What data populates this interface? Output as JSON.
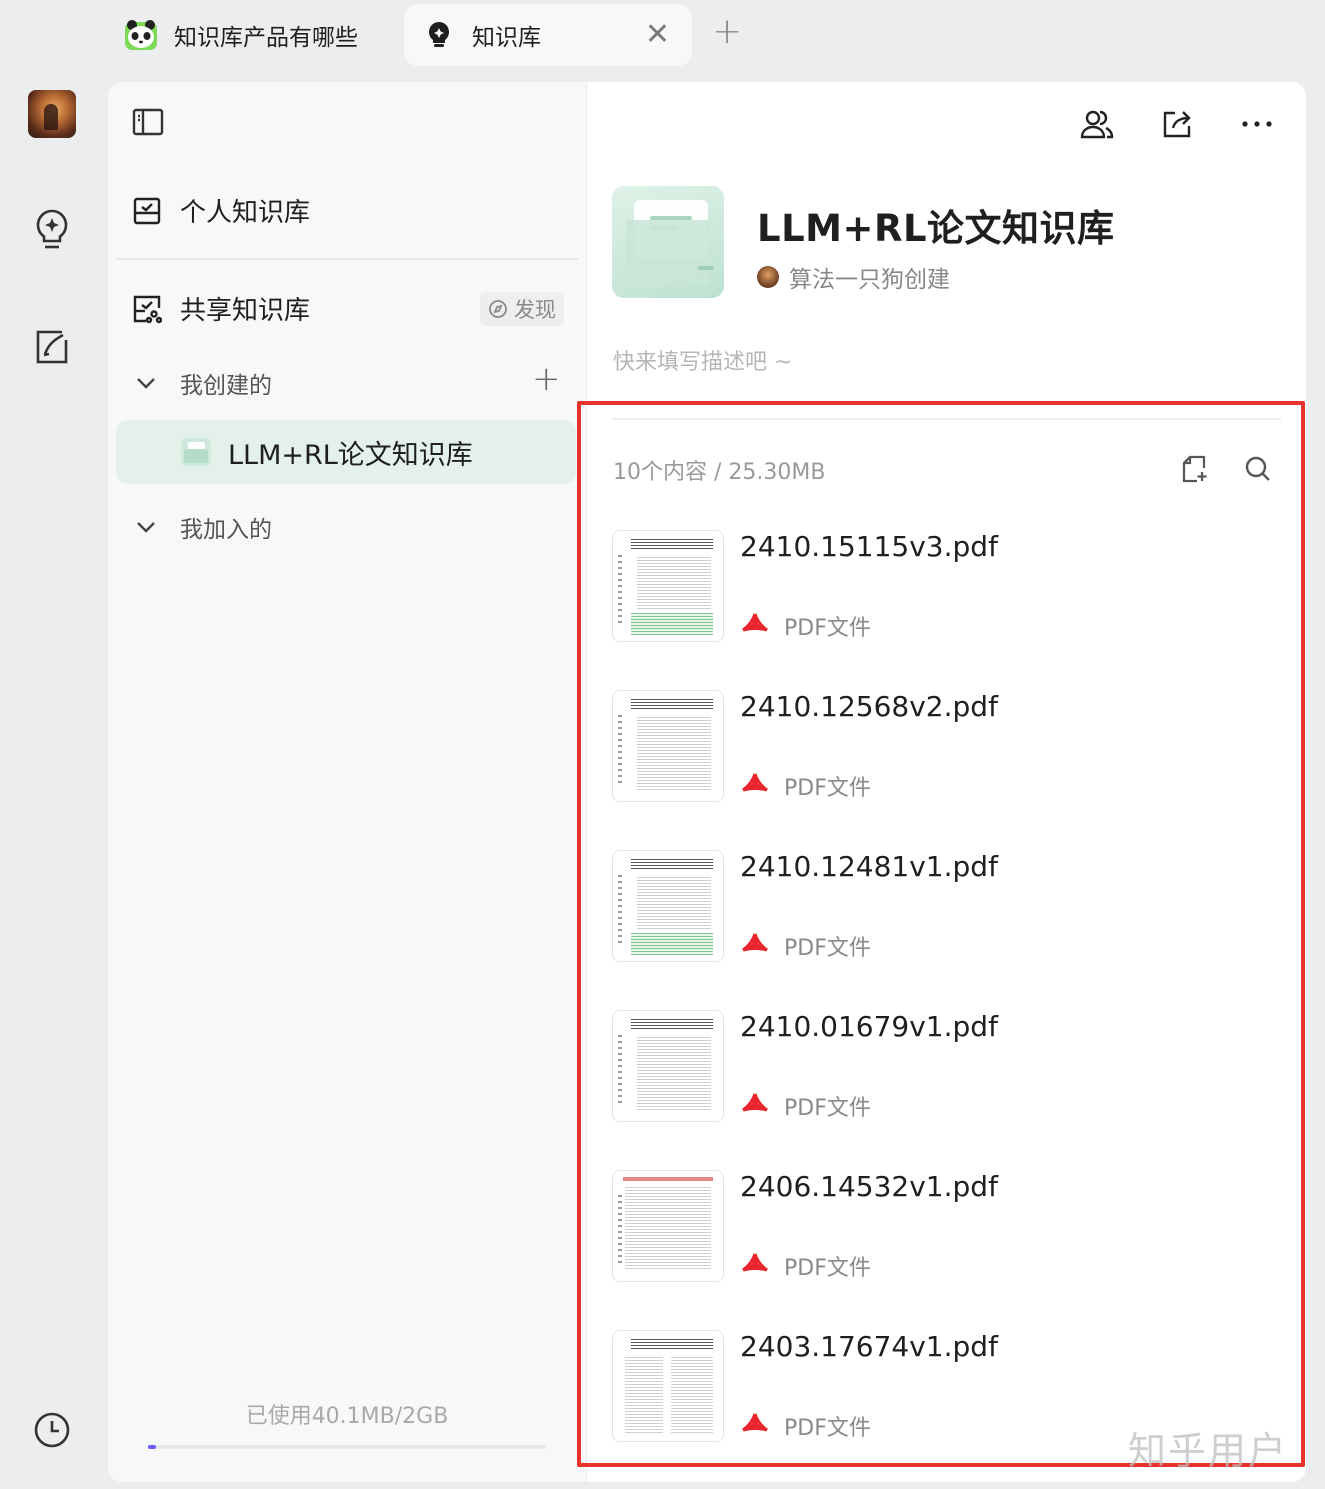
{
  "tabs": [
    {
      "label": "知识库产品有哪些",
      "icon": "panda-icon",
      "active": false
    },
    {
      "label": "知识库",
      "icon": "bulb-icon",
      "active": true
    }
  ],
  "tab_close": "✕",
  "tab_add": "+",
  "sidebar": {
    "personal_label": "个人知识库",
    "shared_label": "共享知识库",
    "discover_label": "发现",
    "groups": {
      "created": {
        "label": "我创建的"
      },
      "joined": {
        "label": "我加入的"
      }
    },
    "active_item": "LLM+RL论文知识库",
    "storage_text": "已使用40.1MB/2GB",
    "storage_used_fraction": 0.0196
  },
  "main": {
    "title": "LLM+RL论文知识库",
    "creator": "算法一只狗创建",
    "description_placeholder": "快来填写描述吧 ~",
    "content_count": "10个内容 / 25.30MB",
    "files": [
      {
        "name": "2410.15115v3.pdf",
        "type": "PDF文件"
      },
      {
        "name": "2410.12568v2.pdf",
        "type": "PDF文件"
      },
      {
        "name": "2410.12481v1.pdf",
        "type": "PDF文件"
      },
      {
        "name": "2410.01679v1.pdf",
        "type": "PDF文件"
      },
      {
        "name": "2406.14532v1.pdf",
        "type": "PDF文件"
      },
      {
        "name": "2403.17674v1.pdf",
        "type": "PDF文件"
      }
    ]
  },
  "watermark": "知乎用户",
  "colors": {
    "accent_green": "#e4f0ea",
    "highlight_red": "#e8322c",
    "pdf_red": "#e8242c",
    "storage_fill": "#6a5cff"
  }
}
